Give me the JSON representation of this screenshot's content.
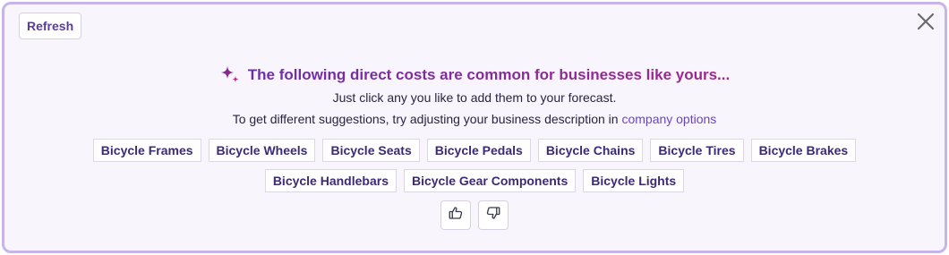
{
  "toolbar": {
    "refresh_label": "Refresh",
    "close_icon": "close-icon"
  },
  "suggestions": {
    "heading": "The following direct costs are common for businesses like yours...",
    "heading_icon": "sparkle-icon",
    "instruction": "Just click any you like to add them to your forecast.",
    "hint_prefix": "To get different suggestions, try adjusting your business description in ",
    "hint_link": "company options",
    "items_row1": [
      "Bicycle Frames",
      "Bicycle Wheels",
      "Bicycle Seats",
      "Bicycle Pedals",
      "Bicycle Chains",
      "Bicycle Tires",
      "Bicycle Brakes"
    ],
    "items_row2": [
      "Bicycle Handlebars",
      "Bicycle Gear Components",
      "Bicycle Lights"
    ]
  },
  "feedback": {
    "like_icon": "thumbs-up-icon",
    "dislike_icon": "thumbs-down-icon"
  },
  "colors": {
    "accent": "#5a3ba0",
    "border": "#c6b4ea",
    "background": "#f8f5fc",
    "link": "#6a45c2"
  }
}
